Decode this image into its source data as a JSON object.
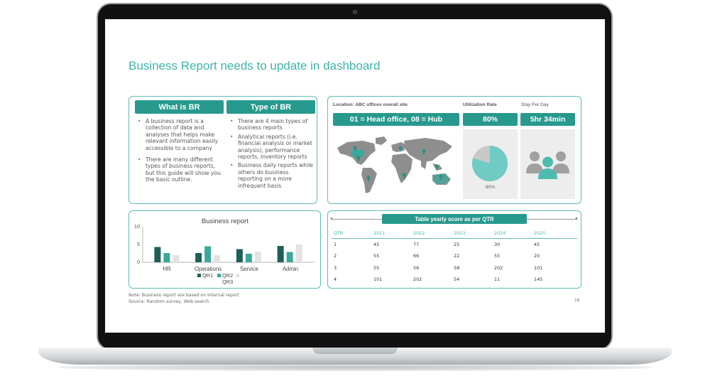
{
  "slide": {
    "title": "Business Report needs to update in dashboard",
    "page_number": "16",
    "note": "Note: Business report are based on internal report",
    "source": "Source:  Random survey, Web search"
  },
  "what_is_br": {
    "header": "What is BR",
    "bullets": [
      "A business report is a collection of data and analyses that helps make relevant information easily accessible to a company",
      "There are many different types of business reports, but this guide will show you the basic outline."
    ]
  },
  "type_of_br": {
    "header": "Type of BR",
    "bullets": [
      "There are 4 main types of business reports",
      "Analytical reports (i.e. financial analysis or market analysis), performance reports, inventory reports",
      "Business daily reports while others do business reporting on a more infrequent basis"
    ]
  },
  "location": {
    "label": "Location: ABC offices overall site",
    "value": "01 = Head office, 08 = Hub",
    "icon": "world-map-icon"
  },
  "utilization": {
    "label": "Utilization Rate",
    "value": "80%",
    "pie_label": "80%",
    "percent": 80
  },
  "stay": {
    "label": "Stay Per Day",
    "value": "5hr 34min",
    "icon": "people-icon"
  },
  "chart_data": {
    "type": "bar",
    "title": "Business report",
    "categories": [
      "HR",
      "Operations",
      "Service",
      "Admin"
    ],
    "series": [
      {
        "name": "QR1",
        "values": [
          4.3,
          2.6,
          3.7,
          4.6
        ],
        "color": "#1f5f57"
      },
      {
        "name": "QR2",
        "values": [
          2.6,
          4.5,
          2.4,
          2.9
        ],
        "color": "#3aa89c"
      },
      {
        "name": "QR3",
        "values": [
          2.0,
          2.0,
          3.0,
          5.0
        ],
        "color": "#e3e3e3"
      }
    ],
    "ylim": [
      0,
      10
    ],
    "yticks": [
      "10",
      "5",
      "0"
    ],
    "legend": "bottom"
  },
  "score_table": {
    "title": "Table yearly score as per  QTR",
    "headers": [
      "QTR",
      "2021",
      "2022",
      "2023",
      "2024",
      "2025"
    ],
    "rows": [
      [
        "1",
        "45",
        "77",
        "25",
        "30",
        "45"
      ],
      [
        "2",
        "55",
        "66",
        "22",
        "55",
        "20"
      ],
      [
        "3",
        "55",
        "56",
        "58",
        "202",
        "101"
      ],
      [
        "4",
        "101",
        "202",
        "54",
        "11",
        "145"
      ]
    ]
  },
  "colors": {
    "teal": "#27998d",
    "teal_light": "#6fcbc3",
    "title_teal": "#3fb3a8"
  }
}
